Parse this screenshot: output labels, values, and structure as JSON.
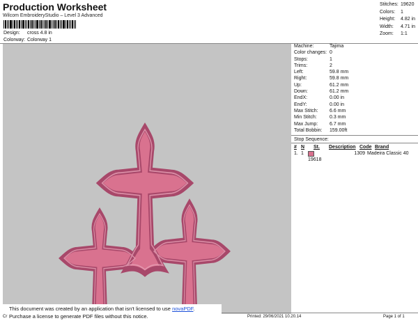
{
  "header": {
    "title": "Production Worksheet",
    "subtitle": "Wilcom EmbroideryStudio – Level 3 Advanced",
    "design_label": "Design:",
    "design_value": "cross 4.8 in",
    "colorway_label": "Colorway:",
    "colorway_value": "Colorway 1"
  },
  "top_stats": [
    {
      "label": "Stitches:",
      "value": "19620"
    },
    {
      "label": "Colors:",
      "value": "1"
    },
    {
      "label": "Height:",
      "value": "4.82 in"
    },
    {
      "label": "Width:",
      "value": "4.71 in"
    },
    {
      "label": "Zoom:",
      "value": "1:1"
    }
  ],
  "machine_info": [
    {
      "label": "Machine:",
      "value": "Tajima"
    },
    {
      "label": "Color changes:",
      "value": "0"
    },
    {
      "label": "Stops:",
      "value": "1"
    },
    {
      "label": "Trims:",
      "value": "2"
    },
    {
      "label": "Left:",
      "value": "59.8 mm"
    },
    {
      "label": "Right:",
      "value": "59.8 mm"
    },
    {
      "label": "Up:",
      "value": "61.2 mm"
    },
    {
      "label": "Down:",
      "value": "61.2 mm"
    },
    {
      "label": "EndX:",
      "value": "0.00 in"
    },
    {
      "label": "EndY:",
      "value": "0.00 in"
    },
    {
      "label": "Max Stitch:",
      "value": "6.6 mm"
    },
    {
      "label": "Min Stitch:",
      "value": "0.3 mm"
    },
    {
      "label": "Max Jump:",
      "value": "6.7 mm"
    },
    {
      "label": "Total Bobbin:",
      "value": "159.00ft"
    }
  ],
  "stop_sequence": {
    "title": "Stop Sequence:",
    "headers": [
      "#",
      "N",
      "St.",
      "Description",
      "Code",
      "Brand"
    ],
    "rows": [
      {
        "index": "1.",
        "n": "1",
        "st": "19618",
        "description": "",
        "code": "1309",
        "brand": "Madeira Classic 40",
        "color": "#d9728f"
      }
    ]
  },
  "footer": {
    "notice_line1_pre": "This document was created by an application that isn't licensed to use ",
    "notice_link": "novaPDF",
    "notice_line1_post": ".",
    "notice_line2": "Purchase a license to generate PDF files without this notice.",
    "cr": "Cr",
    "printed": "Printed: 29/06/2021 10.20.14",
    "page": "Page 1 of 1"
  },
  "design_color": "#d9728f",
  "outline_color": "#b24f6c",
  "canvas_color": "#c4c4c4"
}
